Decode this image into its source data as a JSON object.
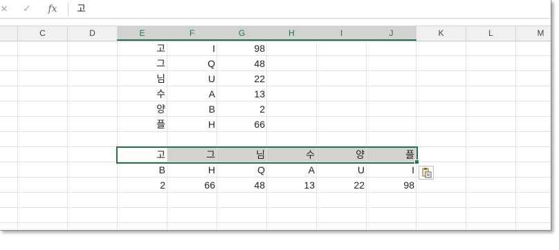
{
  "formula_bar": {
    "cancel_icon": "×",
    "enter_icon": "✓",
    "fx_label": "fx",
    "content": "고"
  },
  "columns": [
    "C",
    "D",
    "E",
    "F",
    "G",
    "H",
    "I",
    "J",
    "K",
    "L",
    "M"
  ],
  "selected_columns": [
    "E",
    "F",
    "G",
    "H",
    "I",
    "J"
  ],
  "source_table": [
    [
      "고",
      "I",
      "98"
    ],
    [
      "그",
      "Q",
      "48"
    ],
    [
      "님",
      "U",
      "22"
    ],
    [
      "수",
      "A",
      "13"
    ],
    [
      "양",
      "B",
      "2"
    ],
    [
      "플",
      "H",
      "66"
    ]
  ],
  "transposed_table": [
    [
      "고",
      "그",
      "님",
      "수",
      "양",
      "플"
    ],
    [
      "B",
      "H",
      "Q",
      "A",
      "U",
      "I"
    ],
    [
      "2",
      "66",
      "48",
      "13",
      "22",
      "98"
    ]
  ],
  "paste_options_icon": "paste-options-icon",
  "colors": {
    "accent": "#217346",
    "header_bg": "#f0f0f0",
    "selection": "#d2d2d2",
    "gridline": "#e1e1e1"
  }
}
